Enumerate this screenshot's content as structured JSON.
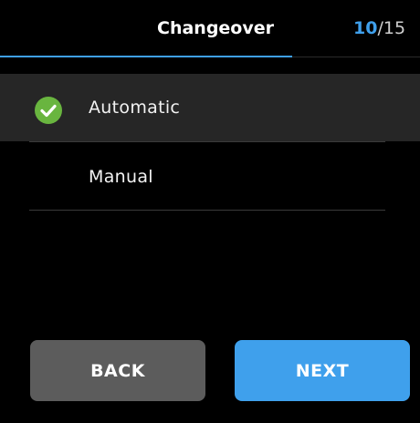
{
  "header": {
    "title": "Changeover",
    "step_current": "10",
    "step_separator": "/",
    "step_total": "15"
  },
  "options": [
    {
      "label": "Automatic",
      "selected": true
    },
    {
      "label": "Manual",
      "selected": false
    }
  ],
  "buttons": {
    "back_label": "BACK",
    "next_label": "NEXT"
  },
  "colors": {
    "accent": "#3fa0ec",
    "check_green": "#69b53f",
    "selected_row_bg": "#262626",
    "back_button_bg": "#5c5c5c"
  },
  "icons": {
    "selected_option": "check-circle-icon"
  }
}
